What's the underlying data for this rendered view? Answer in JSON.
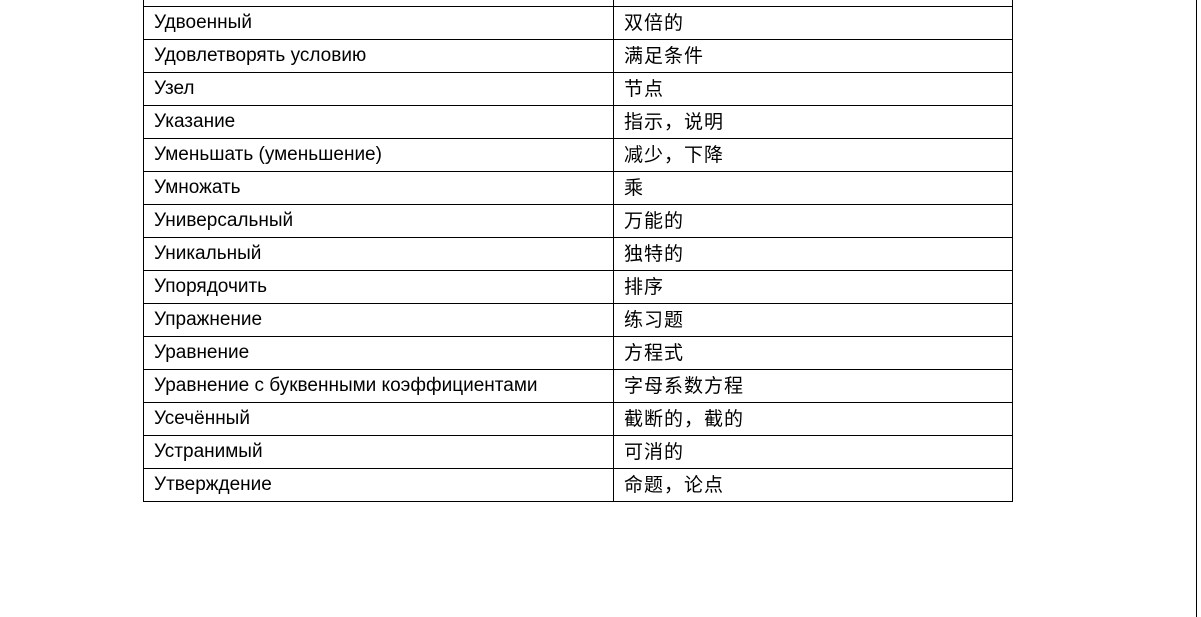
{
  "glossary": {
    "rows": [
      {
        "ru": "Удвоенный",
        "zh": "双倍的"
      },
      {
        "ru": "Удовлетворять условию",
        "zh": "满足条件"
      },
      {
        "ru": "Узел",
        "zh": "节点"
      },
      {
        "ru": "Указание",
        "zh": "指示，说明"
      },
      {
        "ru": "Уменьшать (уменьшение)",
        "zh": "减少，下降"
      },
      {
        "ru": "Умножать",
        "zh": "乘"
      },
      {
        "ru": "Универсальный",
        "zh": "万能的"
      },
      {
        "ru": "Уникальный",
        "zh": "独特的"
      },
      {
        "ru": "Упорядочить",
        "zh": "排序"
      },
      {
        "ru": "Упражнение",
        "zh": "练习题"
      },
      {
        "ru": "Уравнение",
        "zh": "方程式"
      },
      {
        "ru": "Уравнение с буквенными коэффициентами",
        "zh": "字母系数方程"
      },
      {
        "ru": "Усечённый",
        "zh": "截断的，截的"
      },
      {
        "ru": "Устранимый",
        "zh": "可消的"
      },
      {
        "ru": "Утверждение",
        "zh": "命题，论点"
      }
    ]
  }
}
